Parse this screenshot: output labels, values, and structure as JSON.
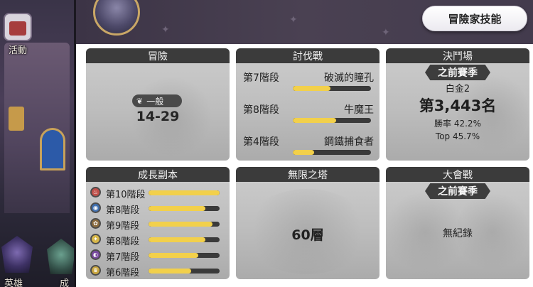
{
  "side_nav": {
    "event_label": "活動",
    "hero_label": "英雄",
    "growth_label": "成"
  },
  "header": {
    "adventurer_skill_button": "冒險家技能"
  },
  "colors": {
    "bar_fill": "#f2d04b",
    "bar_track": "#3a3a3a",
    "card_title_bg": "#3b3b3b"
  },
  "cards": {
    "adventure": {
      "title": "冒險",
      "difficulty": "一般",
      "stage": "14-29"
    },
    "raid": {
      "title": "討伐戰",
      "rows": [
        {
          "level": "第7階段",
          "boss": "破滅的瞳孔",
          "progress": 0.48
        },
        {
          "level": "第8階段",
          "boss": "牛魔王",
          "progress": 0.55
        },
        {
          "level": "第4階段",
          "boss": "鋼鐵捕食者",
          "progress": 0.27
        }
      ]
    },
    "arena": {
      "title": "決鬥場",
      "season": "之前賽季",
      "rank": "白金2",
      "place": "第3,443名",
      "win_rate": "勝率 42.2%",
      "top": "Top 45.7%"
    },
    "growth_dungeon": {
      "title": "成長副本",
      "rows": [
        {
          "level": "第10階段",
          "icon": "fire-element-icon",
          "progress": 1.0
        },
        {
          "level": "第8階段",
          "icon": "water-element-icon",
          "progress": 0.8
        },
        {
          "level": "第9階段",
          "icon": "earth-element-icon",
          "progress": 0.9
        },
        {
          "level": "第8階段",
          "icon": "light-element-icon",
          "progress": 0.8
        },
        {
          "level": "第7階段",
          "icon": "dark-element-icon",
          "progress": 0.7
        },
        {
          "level": "第6階段",
          "icon": "gold-element-icon",
          "progress": 0.6
        }
      ]
    },
    "infinite_tower": {
      "title": "無限之塔",
      "floor": "60層"
    },
    "guild_war": {
      "title": "大會戰",
      "season": "之前賽季",
      "record": "無紀錄"
    }
  }
}
